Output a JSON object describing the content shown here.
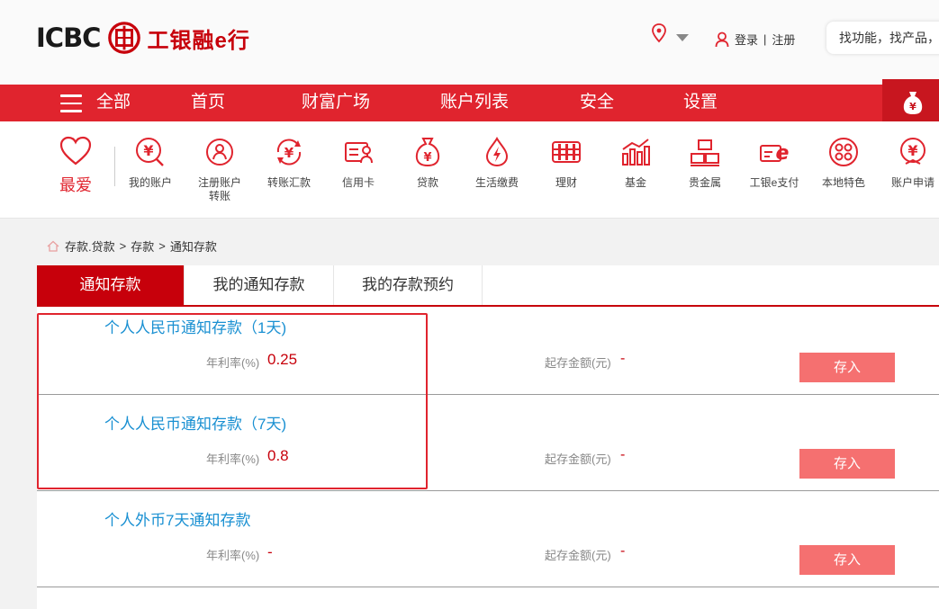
{
  "brand": {
    "logo_text": "ICBC",
    "logo_cn": "工银融e行",
    "seal_char": "工"
  },
  "header": {
    "login": "登录",
    "separator": "|",
    "register": "注册",
    "search_placeholder": "找功能，找产品，"
  },
  "nav": {
    "all": "全部",
    "items": [
      "首页",
      "财富广场",
      "账户列表",
      "安全",
      "设置"
    ]
  },
  "quick": {
    "favorite": "最爱",
    "items": [
      {
        "icon": "yen-search-icon",
        "label": "我的账户"
      },
      {
        "icon": "register-account-icon",
        "label": "注册账户\n转账"
      },
      {
        "icon": "transfer-icon",
        "label": "转账汇款"
      },
      {
        "icon": "credit-card-icon",
        "label": "信用卡"
      },
      {
        "icon": "loan-bag-icon",
        "label": "贷款"
      },
      {
        "icon": "utility-drop-icon",
        "label": "生活缴费"
      },
      {
        "icon": "abacus-icon",
        "label": "理财"
      },
      {
        "icon": "fund-chart-icon",
        "label": "基金"
      },
      {
        "icon": "gold-bars-icon",
        "label": "贵金属"
      },
      {
        "icon": "epay-icon",
        "label": "工银e支付"
      },
      {
        "icon": "local-feature-icon",
        "label": "本地特色"
      },
      {
        "icon": "account-apply-icon",
        "label": "账户申请"
      }
    ]
  },
  "breadcrumb": {
    "items": [
      "存款.贷款",
      ">",
      "存款",
      ">",
      "通知存款"
    ]
  },
  "tabs": [
    "通知存款",
    "我的通知存款",
    "我的存款预约"
  ],
  "products": [
    {
      "name": "个人人民币通知存款（1天)",
      "rate_label": "年利率(%)",
      "rate": "0.25",
      "min_label": "起存金额(元)",
      "min": "-",
      "action": "存入"
    },
    {
      "name": "个人人民币通知存款（7天)",
      "rate_label": "年利率(%)",
      "rate": "0.8",
      "min_label": "起存金额(元)",
      "min": "-",
      "action": "存入"
    },
    {
      "name": "个人外币7天通知存款",
      "rate_label": "年利率(%)",
      "rate": "-",
      "min_label": "起存金额(元)",
      "min": "-",
      "action": "存入"
    }
  ],
  "colors": {
    "brand_red": "#c7000b",
    "nav_red": "#e0242e",
    "link_blue": "#1a90d2",
    "button_pink": "#f57070"
  }
}
